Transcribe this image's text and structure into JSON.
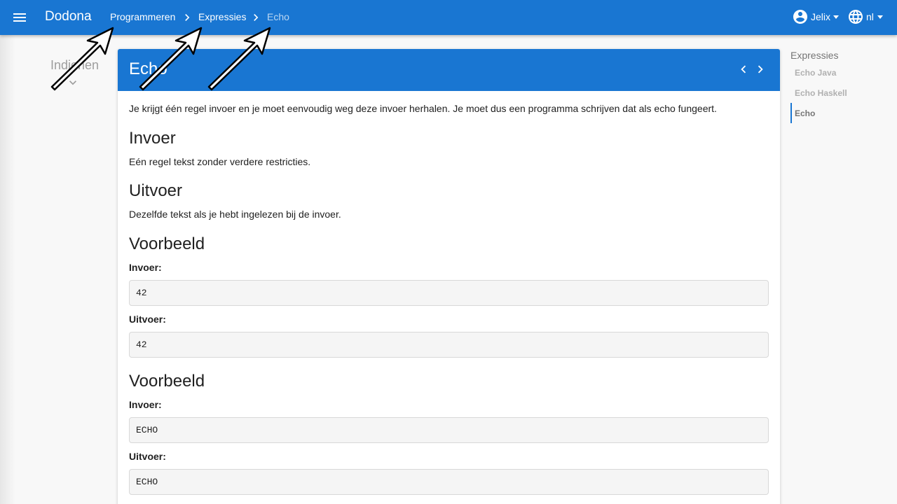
{
  "app": {
    "brand": "Dodona"
  },
  "breadcrumbs": [
    {
      "label": "Programmeren"
    },
    {
      "label": "Expressies"
    },
    {
      "label": "Echo"
    }
  ],
  "user": {
    "name": "Jelix",
    "language": "nl"
  },
  "left_sidebar": {
    "indienen": "Indienen"
  },
  "exercise": {
    "title": "Echo",
    "description": "Je krijgt één regel invoer en je moet eenvoudig weg deze invoer herhalen. Je moet dus een programma schrijven dat als echo fungeert.",
    "sections": [
      {
        "heading": "Invoer",
        "text": "Eén regel tekst zonder verdere restricties."
      },
      {
        "heading": "Uitvoer",
        "text": "Dezelfde tekst als je hebt ingelezen bij de invoer."
      }
    ],
    "examples": [
      {
        "heading": "Voorbeeld",
        "input_label": "Invoer:",
        "input": "42",
        "output_label": "Uitvoer:",
        "output": "42"
      },
      {
        "heading": "Voorbeeld",
        "input_label": "Invoer:",
        "input": "ECHO",
        "output_label": "Uitvoer:",
        "output": "ECHO"
      }
    ]
  },
  "right_sidebar": {
    "title": "Expressies",
    "items": [
      {
        "label": "Echo Java",
        "active": false
      },
      {
        "label": "Echo Haskell",
        "active": false
      },
      {
        "label": "Echo",
        "active": true
      }
    ]
  },
  "colors": {
    "primary": "#1976d2",
    "background": "#f8f8f8",
    "code_background": "#f5f5f5"
  },
  "icons": [
    "menu-icon",
    "chevron-right-icon",
    "account-circle-icon",
    "globe-icon",
    "caret-down-icon",
    "chevron-left-icon",
    "chevron-down-icon",
    "annotation-arrow"
  ]
}
